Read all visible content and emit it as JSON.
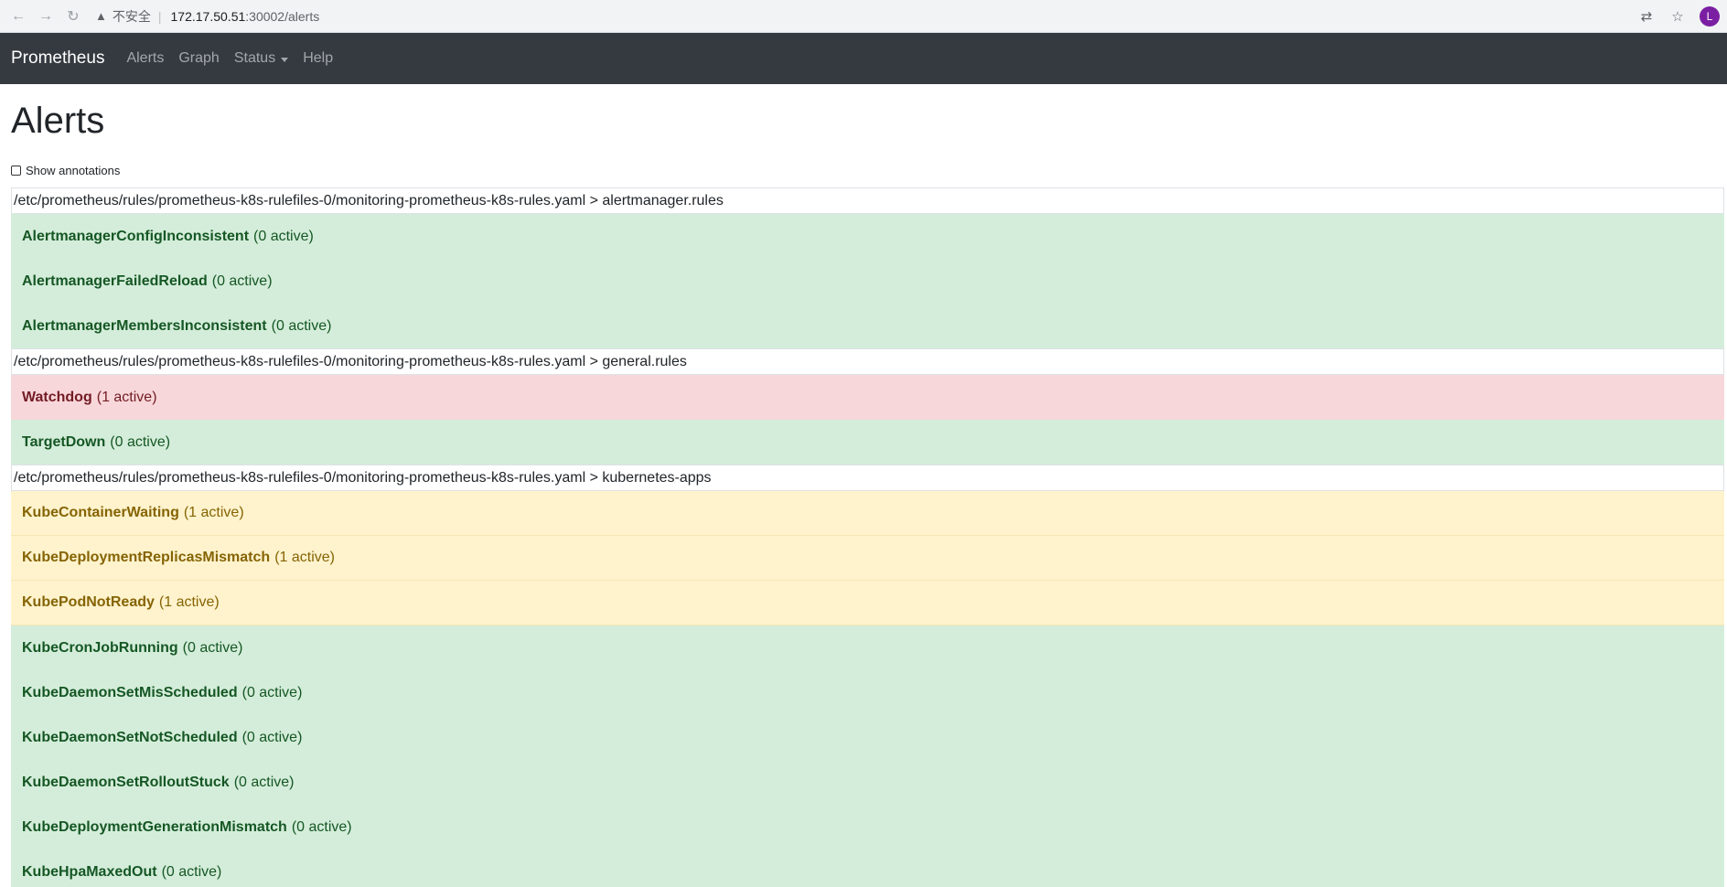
{
  "browser": {
    "insecure_label": "不安全",
    "url_host": "172.17.50.51",
    "url_path": ":30002/alerts",
    "profile_initial": "L"
  },
  "navbar": {
    "brand": "Prometheus",
    "links": [
      "Alerts",
      "Graph",
      "Status",
      "Help"
    ]
  },
  "page": {
    "title": "Alerts",
    "show_annotations_label": "Show annotations",
    "show_annotations_checked": false
  },
  "groups": [
    {
      "header": "/etc/prometheus/rules/prometheus-k8s-rulefiles-0/monitoring-prometheus-k8s-rules.yaml > alertmanager.rules",
      "rules": [
        {
          "name": "AlertmanagerConfigInconsistent",
          "count": "(0 active)",
          "state": "inactive"
        },
        {
          "name": "AlertmanagerFailedReload",
          "count": "(0 active)",
          "state": "inactive"
        },
        {
          "name": "AlertmanagerMembersInconsistent",
          "count": "(0 active)",
          "state": "inactive"
        }
      ]
    },
    {
      "header": "/etc/prometheus/rules/prometheus-k8s-rulefiles-0/monitoring-prometheus-k8s-rules.yaml > general.rules",
      "rules": [
        {
          "name": "Watchdog",
          "count": "(1 active)",
          "state": "firing"
        },
        {
          "name": "TargetDown",
          "count": "(0 active)",
          "state": "inactive"
        }
      ]
    },
    {
      "header": "/etc/prometheus/rules/prometheus-k8s-rulefiles-0/monitoring-prometheus-k8s-rules.yaml > kubernetes-apps",
      "rules": [
        {
          "name": "KubeContainerWaiting",
          "count": "(1 active)",
          "state": "pending"
        },
        {
          "name": "KubeDeploymentReplicasMismatch",
          "count": "(1 active)",
          "state": "pending"
        },
        {
          "name": "KubePodNotReady",
          "count": "(1 active)",
          "state": "pending"
        },
        {
          "name": "KubeCronJobRunning",
          "count": "(0 active)",
          "state": "inactive"
        },
        {
          "name": "KubeDaemonSetMisScheduled",
          "count": "(0 active)",
          "state": "inactive"
        },
        {
          "name": "KubeDaemonSetNotScheduled",
          "count": "(0 active)",
          "state": "inactive"
        },
        {
          "name": "KubeDaemonSetRolloutStuck",
          "count": "(0 active)",
          "state": "inactive"
        },
        {
          "name": "KubeDeploymentGenerationMismatch",
          "count": "(0 active)",
          "state": "inactive"
        },
        {
          "name": "KubeHpaMaxedOut",
          "count": "(0 active)",
          "state": "inactive"
        }
      ]
    }
  ],
  "colors": {
    "inactive_bg": "#d4edda",
    "firing_bg": "#f8d7da",
    "pending_bg": "#fff3cd",
    "navbar_bg": "#343a40"
  }
}
